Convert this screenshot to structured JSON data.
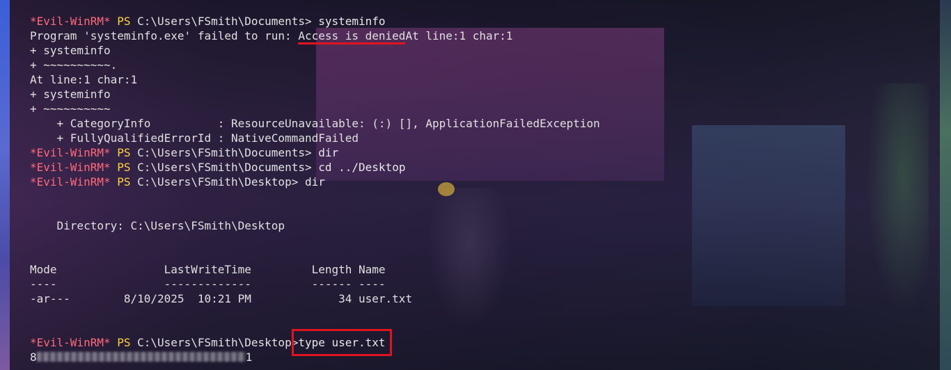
{
  "prompt": {
    "prefix": "*Evil-WinRM*",
    "shell": "PS"
  },
  "lines": [
    {
      "type": "cmd",
      "path": "C:\\Users\\FSmith\\Documents>",
      "cmd": " systeminfo"
    },
    {
      "type": "err-head",
      "before": "Program 'systeminfo.exe' failed to run: ",
      "marked": "Access is denied",
      "after": "At line:1 char:1"
    },
    {
      "type": "out",
      "text": "+ systeminfo"
    },
    {
      "type": "out",
      "text": "+ ~~~~~~~~~~."
    },
    {
      "type": "out",
      "text": "At line:1 char:1"
    },
    {
      "type": "out",
      "text": "+ systeminfo"
    },
    {
      "type": "out",
      "text": "+ ~~~~~~~~~~"
    },
    {
      "type": "out",
      "text": "    + CategoryInfo          : ResourceUnavailable: (:) [], ApplicationFailedException"
    },
    {
      "type": "out",
      "text": "    + FullyQualifiedErrorId : NativeCommandFailed"
    },
    {
      "type": "cmd",
      "path": "C:\\Users\\FSmith\\Documents>",
      "cmd": " dir"
    },
    {
      "type": "cmd",
      "path": "C:\\Users\\FSmith\\Documents>",
      "cmd": " cd ../Desktop"
    },
    {
      "type": "cmd",
      "path": "C:\\Users\\FSmith\\Desktop>",
      "cmd": " dir"
    },
    {
      "type": "blank",
      "text": ""
    },
    {
      "type": "blank",
      "text": ""
    },
    {
      "type": "out",
      "text": "    Directory: C:\\Users\\FSmith\\Desktop"
    },
    {
      "type": "blank",
      "text": ""
    },
    {
      "type": "blank",
      "text": ""
    },
    {
      "type": "out",
      "text": "Mode                LastWriteTime         Length Name"
    },
    {
      "type": "out",
      "text": "----                -------------         ------ ----"
    },
    {
      "type": "out",
      "text": "-ar---        8/10/2025  10:21 PM             34 user.txt"
    },
    {
      "type": "blank",
      "text": ""
    },
    {
      "type": "blank",
      "text": ""
    },
    {
      "type": "cmd-boxed",
      "path": "C:\\Users\\FSmith\\Desktop>",
      "cmd": "type user.txt"
    },
    {
      "type": "flag",
      "first": "8",
      "last": "1"
    }
  ]
}
